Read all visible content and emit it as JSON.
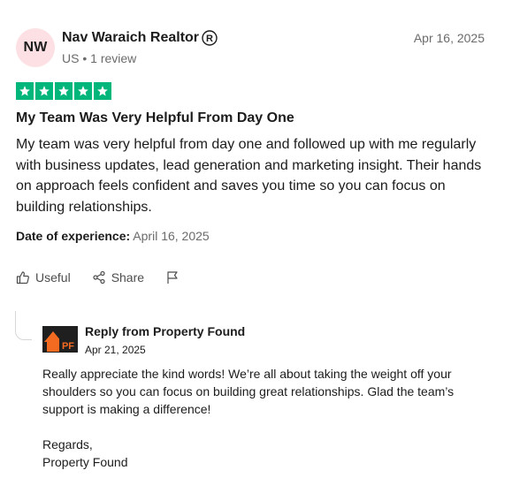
{
  "reviewer": {
    "initials": "NW",
    "name": "Nav Waraich Realtor",
    "country": "US",
    "separator": "•",
    "review_count": "1 review",
    "registered_mark_icon": "registered-trademark-icon"
  },
  "review": {
    "date": "Apr 16, 2025",
    "rating": 5,
    "max_rating": 5,
    "star_color": "#00b67a",
    "title": "My Team Was Very Helpful From Day One",
    "body": "My team was very helpful from day one and followed up with me regularly with business updates, lead generation and marketing insight. Their hands on approach feels confident and saves you time so you can focus on building relationships.",
    "experience_label": "Date of experience:",
    "experience_date": "April 16, 2025"
  },
  "actions": {
    "useful_label": "Useful",
    "share_label": "Share",
    "useful_icon": "thumbs-up-icon",
    "share_icon": "share-icon",
    "flag_icon": "flag-icon"
  },
  "reply": {
    "heading": "Reply from Property Found",
    "date": "Apr 21, 2025",
    "body": "Really appreciate the kind words! We’re all about taking the weight off your shoulders so you can focus on building great relationships. Glad the team’s support is making a difference!",
    "signoff_line1": "Regards,",
    "signoff_line2": "Property Found",
    "logo_text": "PF",
    "logo_colors": {
      "orange": "#f26b21",
      "dark": "#1f1f1f"
    }
  },
  "colors": {
    "avatar_bg": "#fce0e3",
    "muted_text": "#6b6b6b",
    "primary_text": "#1c1c1c"
  }
}
